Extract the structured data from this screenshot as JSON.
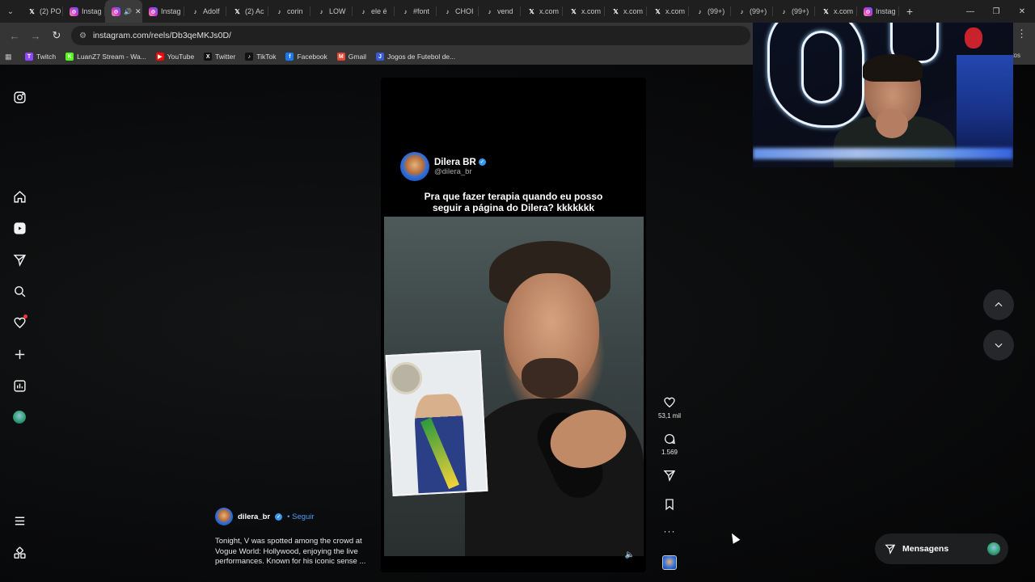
{
  "tabs": [
    {
      "icon": "x",
      "label": "(2) PO"
    },
    {
      "icon": "ig",
      "label": "Instag"
    },
    {
      "icon": "ig",
      "label": "",
      "active": true
    },
    {
      "icon": "ig",
      "label": "Instag"
    },
    {
      "icon": "tt",
      "label": "Adolf"
    },
    {
      "icon": "x",
      "label": "(2) Ac"
    },
    {
      "icon": "tt",
      "label": "corin"
    },
    {
      "icon": "tt",
      "label": "LOW"
    },
    {
      "icon": "tt",
      "label": "ele é"
    },
    {
      "icon": "tt",
      "label": "#font"
    },
    {
      "icon": "tt",
      "label": "CHOI"
    },
    {
      "icon": "tt",
      "label": "vend"
    },
    {
      "icon": "x",
      "label": "x.com"
    },
    {
      "icon": "x",
      "label": "x.com"
    },
    {
      "icon": "x",
      "label": "x.com"
    },
    {
      "icon": "x",
      "label": "x.com"
    },
    {
      "icon": "tt",
      "label": "(99+)"
    },
    {
      "icon": "tt",
      "label": "(99+)"
    },
    {
      "icon": "tt",
      "label": "(99+)"
    },
    {
      "icon": "x",
      "label": "x.com"
    },
    {
      "icon": "ig",
      "label": "Instag"
    }
  ],
  "toolbar": {
    "url": "instagram.com/reels/Db3qeMKJs0D/"
  },
  "bookmarks": [
    {
      "label": "Twitch",
      "color": "#9146ff",
      "glyph": "T"
    },
    {
      "label": "LuanZ7 Stream - Wa...",
      "color": "#53fc18",
      "glyph": "K"
    },
    {
      "label": "YouTube",
      "color": "#ff0000",
      "glyph": "▶"
    },
    {
      "label": "Twitter",
      "color": "#111111",
      "glyph": "X"
    },
    {
      "label": "TikTok",
      "color": "#111111",
      "glyph": "♪"
    },
    {
      "label": "Facebook",
      "color": "#1877f2",
      "glyph": "f"
    },
    {
      "label": "Gmail",
      "color": "#ea4335",
      "glyph": "M"
    },
    {
      "label": "Jogos de Futebol de...",
      "color": "#3a5bd9",
      "glyph": "J"
    }
  ],
  "bookmarks_right": "ritos",
  "reel": {
    "name": "Dilera BR",
    "handle": "@dilera_br",
    "caption_line1": "Pra que fazer terapia quando eu posso",
    "caption_line2": "seguir a página do Dilera? kkkkkkk"
  },
  "actions": {
    "likes": "53,1 mil",
    "comments": "1.569"
  },
  "post": {
    "username": "dilera_br",
    "follow": "• Seguir",
    "text_line1": "Tonight, V was spotted among the crowd at",
    "text_line2": "Vogue World: Hollywood, enjoying the live",
    "text_line3": "performances. Known for his iconic sense ..."
  },
  "messages": {
    "label": "Mensagens"
  }
}
